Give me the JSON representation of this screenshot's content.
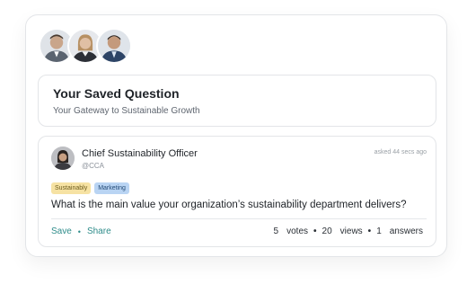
{
  "avatars": [
    {
      "alt": "user-1"
    },
    {
      "alt": "user-2"
    },
    {
      "alt": "user-3"
    }
  ],
  "saved_question": {
    "title": "Your Saved Question",
    "subtitle": "Your Gateway to Sustainable Growth"
  },
  "post": {
    "author": "Chief Sustainability Officer",
    "handle": "@CCA",
    "asked": "asked 44 secs ago",
    "tags": [
      "Sustainably",
      "Marketing"
    ],
    "question": "What is the main value your organization’s sustainability department delivers?",
    "actions": {
      "save": "Save",
      "separator": "•",
      "share": "Share"
    },
    "stats": {
      "votes_count": "5",
      "votes_label": "votes",
      "views_count": "20",
      "views_label": "views",
      "answers_count": "1",
      "answers_label": "answers",
      "separator": "•"
    }
  },
  "colors": {
    "action": "#2e8c8a",
    "tag_sustainably": "#f6e2a3",
    "tag_marketing": "#b9d4f3"
  }
}
